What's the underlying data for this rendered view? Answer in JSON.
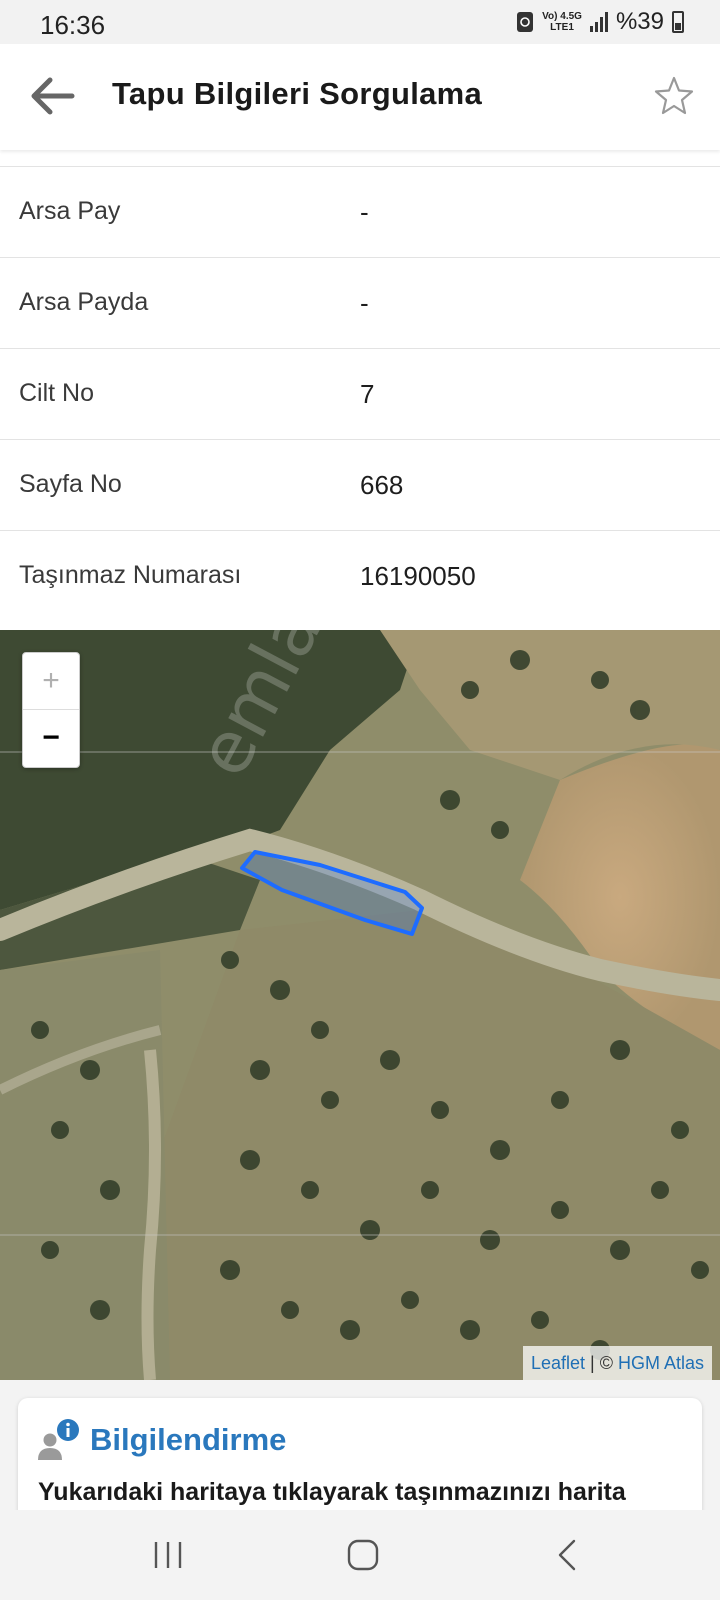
{
  "status_bar": {
    "time": "16:36",
    "network_top": "Vo) 4.5G",
    "network_bottom": "LTE1",
    "battery": "%39",
    "icons": [
      "sync-icon",
      "signal-icon",
      "battery-icon"
    ]
  },
  "app_bar": {
    "title": "Tapu Bilgileri Sorgulama",
    "back_icon": "arrow-left-icon",
    "favorite_icon": "star-outline-icon"
  },
  "details": [
    {
      "label": "Arsa Pay",
      "value": "-"
    },
    {
      "label": "Arsa Payda",
      "value": "-"
    },
    {
      "label": "Cilt No",
      "value": "7"
    },
    {
      "label": "Sayfa No",
      "value": "668"
    },
    {
      "label": "Taşınmaz Numarası",
      "value": "16190050"
    }
  ],
  "map": {
    "zoom_in": "+",
    "zoom_out": "−",
    "attribution_link": "Leaflet",
    "attribution_sep": " | © ",
    "attribution_source": "HGM Atlas",
    "watermark": "emlakjet.com",
    "parcel_color": "#1e6cff"
  },
  "info_card": {
    "title": "Bilgilendirme",
    "text": "Yukarıdaki haritaya tıklayarak taşınmazınızı harita",
    "icon": "user-info-icon",
    "accent": "#2a78bd"
  },
  "nav_bar": {
    "icons": [
      "recent-apps-icon",
      "home-icon",
      "back-icon"
    ]
  }
}
